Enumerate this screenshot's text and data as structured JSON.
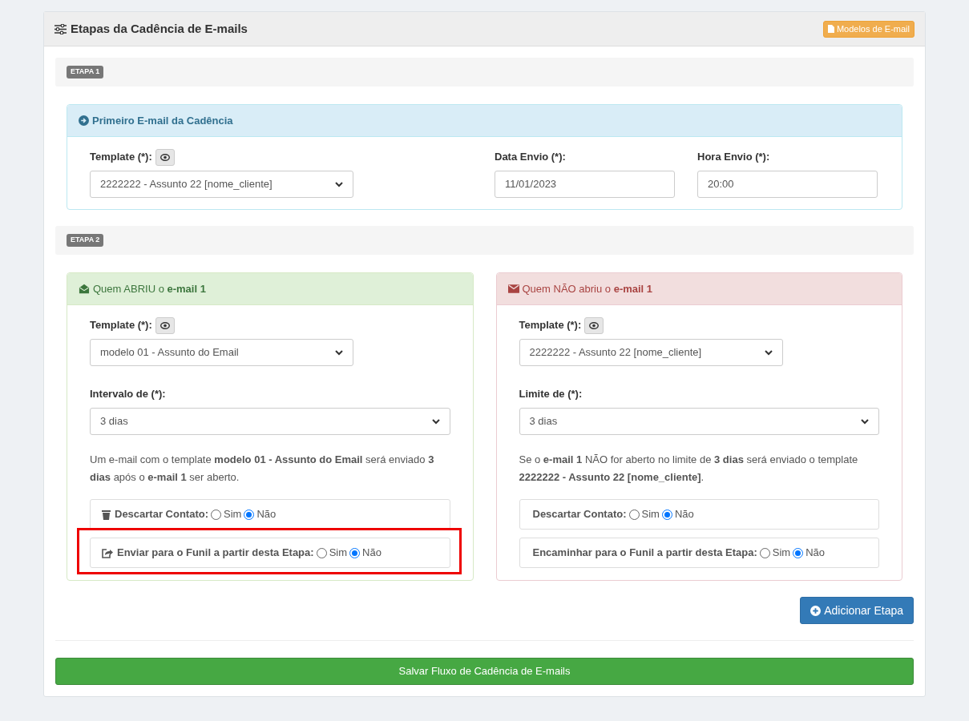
{
  "header": {
    "title": "Etapas da Cadência de E-mails",
    "models_button": "Modelos de E-mail"
  },
  "steps": [
    {
      "badge": "ETAPA 1",
      "panels": [
        {
          "kind": "info",
          "title": "Primeiro E-mail da Cadência",
          "fields": [
            {
              "kind": "select",
              "label": "Template (*):",
              "preview": true,
              "value": "2222222 - Assunto 22 [nome_cliente]"
            },
            {
              "kind": "input",
              "label": "Data Envio (*):",
              "value": "11/01/2023"
            },
            {
              "kind": "input",
              "label": "Hora Envio (*):",
              "value": "20:00"
            }
          ]
        }
      ]
    },
    {
      "badge": "ETAPA 2",
      "panels": [
        {
          "kind": "success",
          "title": "Quem ABRIU o **e-mail 1**",
          "fields": [
            {
              "kind": "select",
              "label": "Template (*):",
              "preview": true,
              "value": "modelo 01 - Assunto do Email"
            },
            {
              "kind": "select",
              "label": "Intervalo de (*):",
              "preview": false,
              "value": "3 dias"
            }
          ],
          "description": "Um e-mail com o template **modelo 01 - Assunto do Email** será enviado **3 dias** após o **e-mail 1** ser aberto.",
          "options": [
            {
              "label": "Descartar Contato:",
              "highlighted": false,
              "choices": [
                {
                  "label": "Sim",
                  "selected": false
                },
                {
                  "label": "Não",
                  "selected": true
                }
              ]
            },
            {
              "label": "Enviar para o Funil a partir desta Etapa:",
              "highlighted": true,
              "choices": [
                {
                  "label": "Sim",
                  "selected": false
                },
                {
                  "label": "Não",
                  "selected": true
                }
              ]
            }
          ]
        },
        {
          "kind": "danger",
          "title": "Quem NÃO abriu o **e-mail 1**",
          "fields": [
            {
              "kind": "select",
              "label": "Template (*):",
              "preview": true,
              "value": "2222222 - Assunto 22 [nome_cliente]"
            },
            {
              "kind": "select",
              "label": "Limite de (*):",
              "preview": false,
              "value": "3 dias"
            }
          ],
          "description": "Se o **e-mail 1** NÃO for aberto no limite de **3 dias** será enviado o template **2222222 - Assunto 22 [nome_cliente]**.",
          "options": [
            {
              "label": "Descartar Contato:",
              "highlighted": false,
              "choices": [
                {
                  "label": "Sim",
                  "selected": false
                },
                {
                  "label": "Não",
                  "selected": true
                }
              ]
            },
            {
              "label": "Encaminhar para o Funil a partir desta Etapa:",
              "highlighted": false,
              "choices": [
                {
                  "label": "Sim",
                  "selected": false
                },
                {
                  "label": "Não",
                  "selected": true
                }
              ]
            }
          ]
        }
      ]
    }
  ],
  "add_button": "Adicionar Etapa",
  "save_button": "Salvar Fluxo de Cadência de E-mails"
}
